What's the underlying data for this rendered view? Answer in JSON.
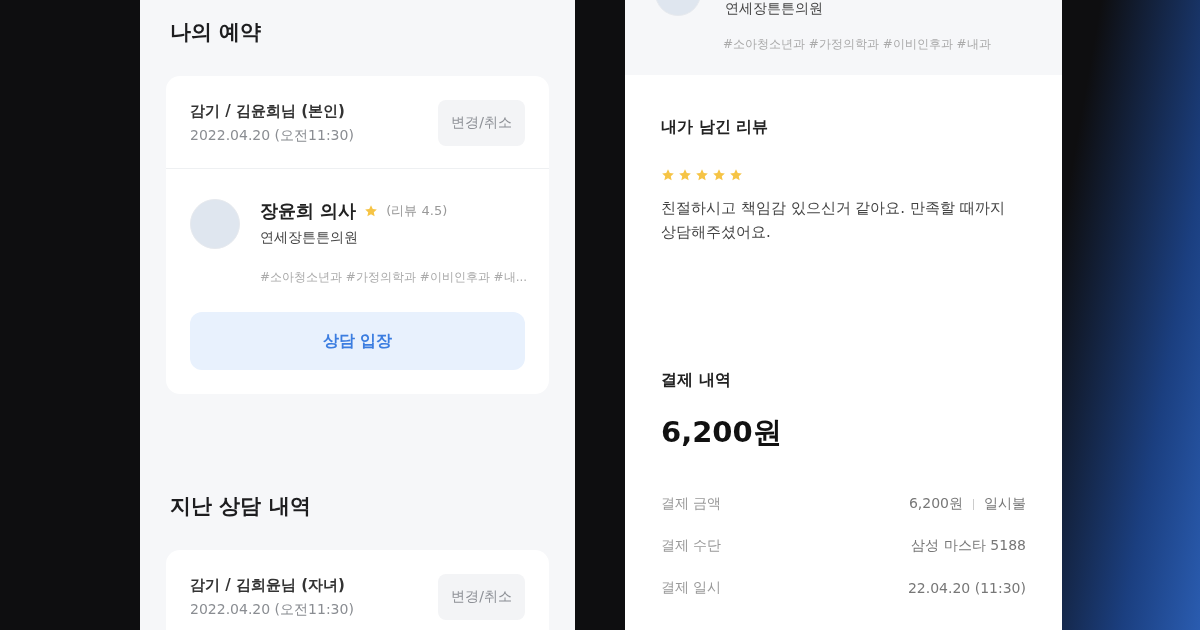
{
  "reservations": {
    "title": "나의 예약",
    "card": {
      "subject": "감기 / 김윤희님 (본인)",
      "date": "2022.04.20 (오전11:30)",
      "action": "변경/취소",
      "doctor": {
        "name": "장윤희 의사",
        "rating": "(리뷰 4.5)",
        "clinic": "연세장튼튼의원",
        "tags": "#소아청소년과 #가정의학과 #이비인후과 #내..."
      },
      "enter": "상담 입장"
    }
  },
  "history": {
    "title": "지난 상담 내역",
    "card": {
      "subject": "감기 / 김희윤님 (자녀)",
      "date": "2022.04.20 (오전11:30)",
      "action": "변경/취소"
    }
  },
  "detail": {
    "clinic": "연세장튼튼의원",
    "tags": "#소아청소년과 #가정의학과 #이비인후과 #내과",
    "review": {
      "title": "내가 남긴 리뷰",
      "stars": 5,
      "text": "친절하시고 책임감 있으신거 같아요. 만족할 때까지 상담해주셨어요."
    },
    "payment": {
      "title": "결제 내역",
      "total": "6,200원",
      "rows": [
        {
          "label": "결제 금액",
          "values": [
            "6,200원",
            "일시불"
          ]
        },
        {
          "label": "결제 수단",
          "values": [
            "삼성 마스타 5188"
          ]
        },
        {
          "label": "결제 일시",
          "values": [
            "22.04.20 (11:30)"
          ]
        }
      ]
    }
  }
}
